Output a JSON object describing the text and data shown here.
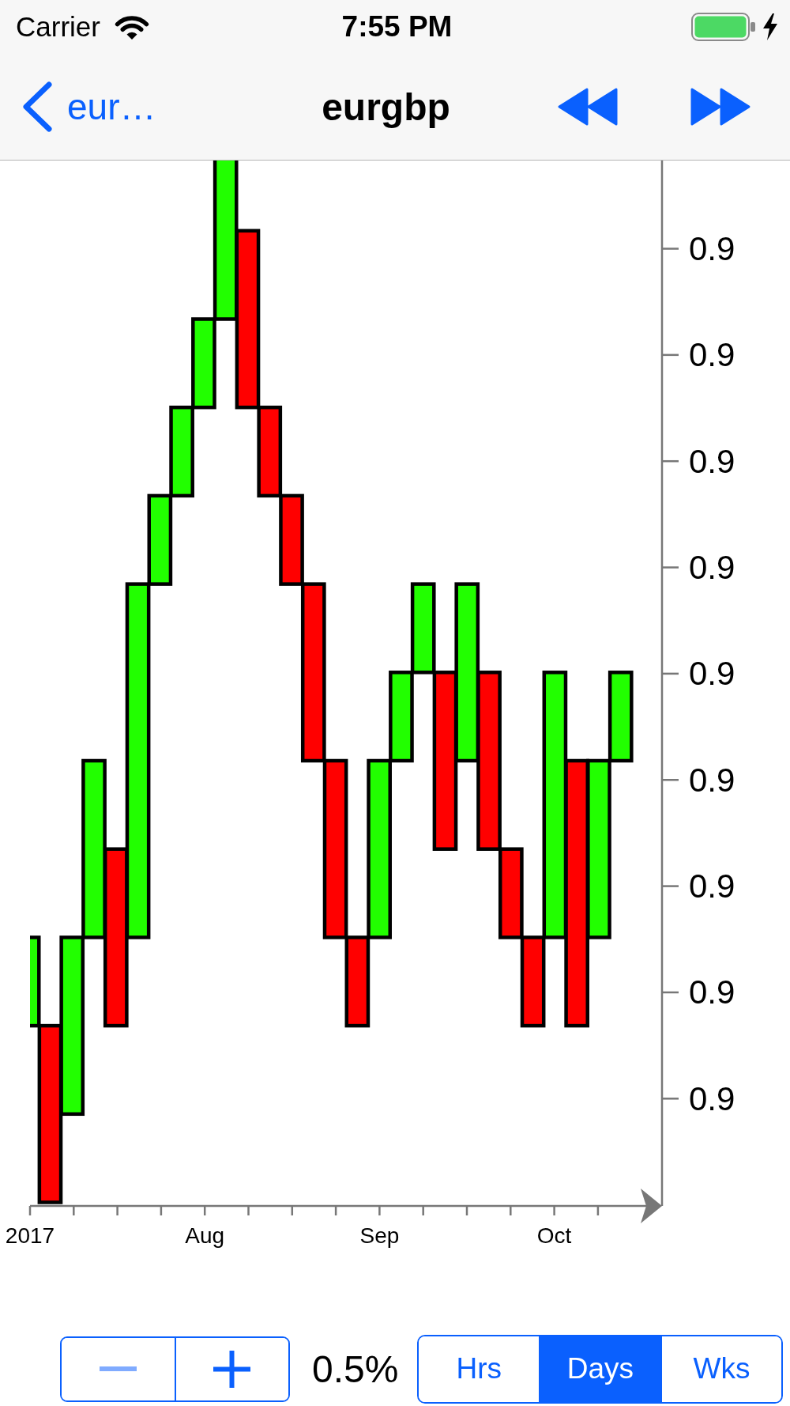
{
  "status_bar": {
    "carrier": "Carrier",
    "time": "7:55 PM",
    "charging": true
  },
  "nav_bar": {
    "back_label": "eur…",
    "title": "eurgbp"
  },
  "chart": {
    "y_axis_labels": [
      "0.9",
      "0.9",
      "0.9",
      "0.9",
      "0.9",
      "0.9",
      "0.9",
      "0.9",
      "0.9"
    ],
    "x_axis_labels": [
      "2017",
      "Aug",
      "Sep",
      "Oct"
    ]
  },
  "stepper": {
    "buttons": [
      {
        "kind": "minus",
        "disabled": true
      },
      {
        "kind": "plus",
        "disabled": false
      }
    ]
  },
  "step_value": "0.5%",
  "interval_segments": [
    {
      "label": "Hrs",
      "selected": false
    },
    {
      "label": "Days",
      "selected": true
    },
    {
      "label": "Wks",
      "selected": false
    }
  ]
}
